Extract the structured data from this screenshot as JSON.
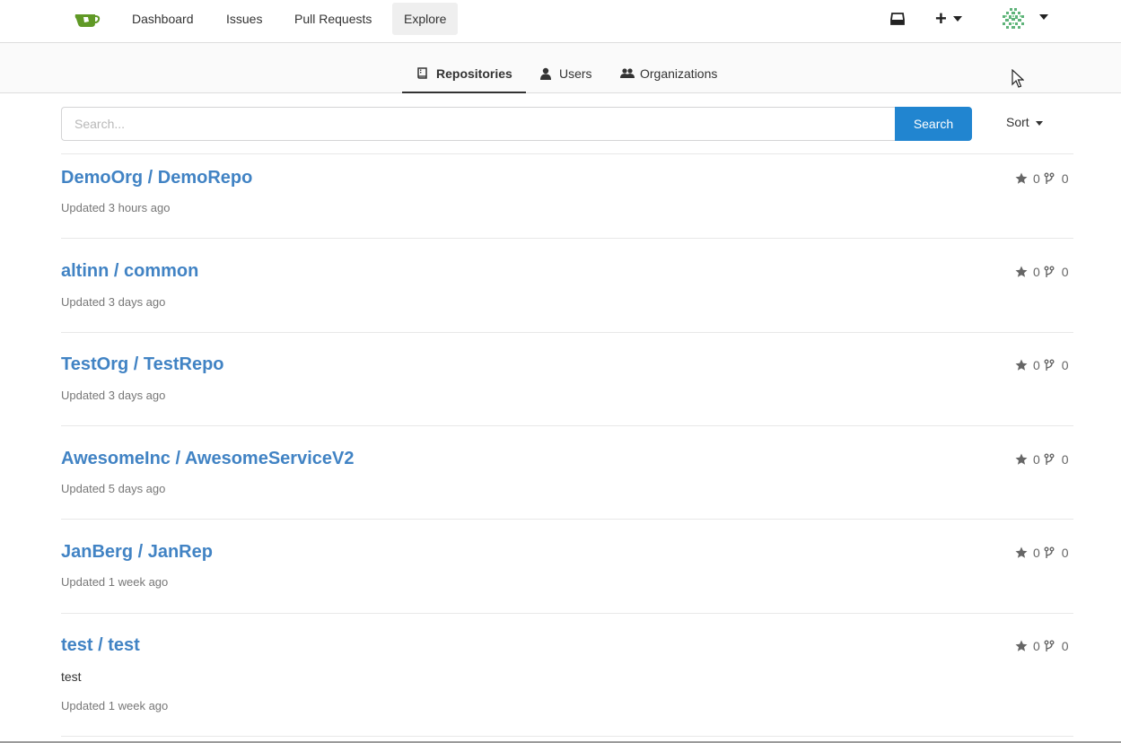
{
  "nav": {
    "items": [
      {
        "label": "Dashboard"
      },
      {
        "label": "Issues"
      },
      {
        "label": "Pull Requests"
      },
      {
        "label": "Explore"
      }
    ]
  },
  "tabs": [
    {
      "label": "Repositories",
      "icon": "repo-book-icon",
      "active": true
    },
    {
      "label": "Users",
      "icon": "user-icon"
    },
    {
      "label": "Organizations",
      "icon": "organization-icon"
    }
  ],
  "search": {
    "placeholder": "Search...",
    "value": "",
    "button_label": "Search"
  },
  "sort": {
    "label": "Sort"
  },
  "repos": [
    {
      "title": "DemoOrg / DemoRepo",
      "description": "",
      "updated": "Updated 3 hours ago",
      "stars": "0",
      "forks": "0"
    },
    {
      "title": "altinn / common",
      "description": "",
      "updated": "Updated 3 days ago",
      "stars": "0",
      "forks": "0"
    },
    {
      "title": "TestOrg / TestRepo",
      "description": "",
      "updated": "Updated 3 days ago",
      "stars": "0",
      "forks": "0"
    },
    {
      "title": "AwesomeInc / AwesomeServiceV2",
      "description": "",
      "updated": "Updated 5 days ago",
      "stars": "0",
      "forks": "0"
    },
    {
      "title": "JanBerg / JanRep",
      "description": "",
      "updated": "Updated 1 week ago",
      "stars": "0",
      "forks": "0"
    },
    {
      "title": "test / test",
      "description": "test",
      "updated": "Updated 1 week ago",
      "stars": "0",
      "forks": "0"
    }
  ],
  "colors": {
    "accent": "#2185d0",
    "link": "#4183c4",
    "logo": "#609926"
  }
}
